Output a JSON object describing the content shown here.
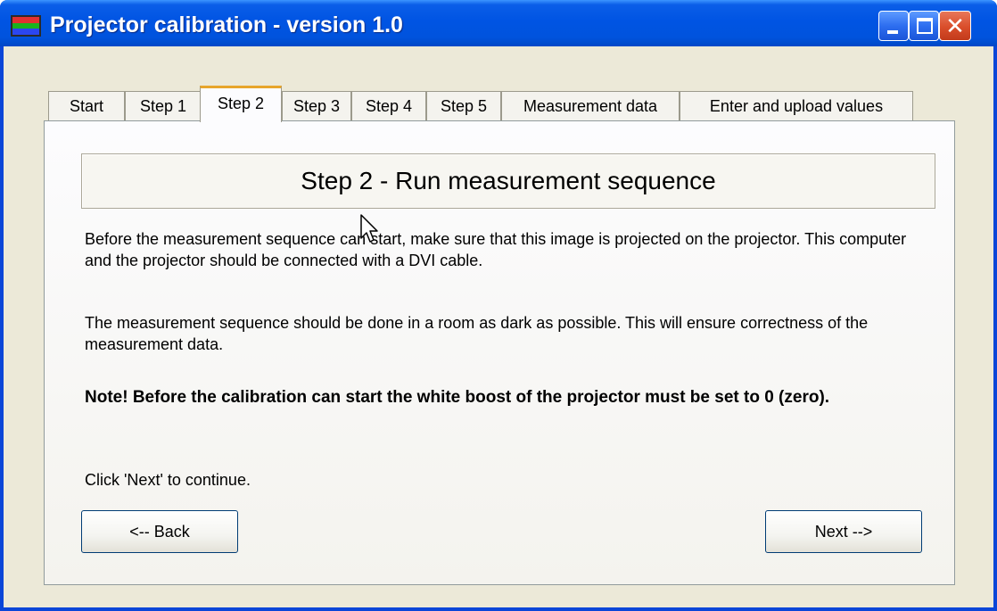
{
  "window": {
    "title": "Projector calibration - version 1.0",
    "controls": {
      "minimize": "minimize",
      "maximize": "maximize",
      "close": "✕"
    }
  },
  "tabs": [
    {
      "label": "Start",
      "active": false
    },
    {
      "label": "Step 1",
      "active": false
    },
    {
      "label": "Step 2",
      "active": true
    },
    {
      "label": "Step 3",
      "active": false
    },
    {
      "label": "Step 4",
      "active": false
    },
    {
      "label": "Step 5",
      "active": false
    },
    {
      "label": "Measurement data",
      "active": false
    },
    {
      "label": "Enter and upload values",
      "active": false
    }
  ],
  "content": {
    "heading": "Step 2 - Run measurement sequence",
    "paragraph1": "Before the measurement sequence can start, make sure that this image is projected on the projector. This computer and the projector should be connected with a DVI cable.",
    "paragraph2": "The measurement sequence should be done in a room as dark as possible. This will ensure correctness of the measurement data.",
    "note": "Note! Before the calibration can start the white boost of the projector must be set to 0 (zero).",
    "instruction": "Click 'Next' to continue."
  },
  "buttons": {
    "back": "<-- Back",
    "next": "Next -->"
  },
  "colors": {
    "titlebar": "#0054e3",
    "active_tab_accent": "#e7a52b",
    "window_bg": "#ece9d8"
  },
  "icons": {
    "app": "rgb-stripes-icon",
    "cursor": "mouse-pointer-icon"
  }
}
